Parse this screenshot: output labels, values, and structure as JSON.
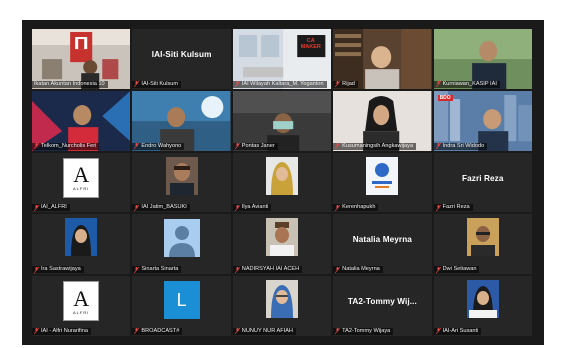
{
  "tiles": [
    {
      "label": "Ikatan Akuntan Indonesia 10"
    },
    {
      "label": "IAI-Siti Kulsum",
      "big": "IAI-Siti Kulsum"
    },
    {
      "label": "IAI Wilayah Kaltara_M. Yoganton",
      "sign": "CA MAKER"
    },
    {
      "label": "Rijad"
    },
    {
      "label": "Kurniawan_KASIP IAI"
    },
    {
      "label": "Telkom_Nurcholis Feri"
    },
    {
      "label": "Endro Wahyono"
    },
    {
      "label": "Pontas Janer"
    },
    {
      "label": "Kusumaningsih Angkawijaya"
    },
    {
      "label": "Indra Sri Widodo",
      "sign": "BDO"
    },
    {
      "label": "IAI_ALFRI",
      "logo_big": "A",
      "logo_small": "ALFRI"
    },
    {
      "label": "IAI Jatim_BASUKI"
    },
    {
      "label": "Ilya Avianti"
    },
    {
      "label": "Kerenhapukh"
    },
    {
      "label": "Fazri Reza",
      "big": "Fazri Reza"
    },
    {
      "label": "Ira Sastrawijaya"
    },
    {
      "label": "Sinarta Sinarta"
    },
    {
      "label": "NADIRSYAH IAI ACEH"
    },
    {
      "label": "Natalia Meyrna",
      "big": "Natalia Meyrna"
    },
    {
      "label": "Dwi Setiawan"
    },
    {
      "label": "IAI - Alfri Nurarifina",
      "logo_big": "A",
      "logo_small": "ALFRI"
    },
    {
      "label": "BROADCAST#",
      "logo_big": "L"
    },
    {
      "label": "NUNUY NUR AFIAH"
    },
    {
      "label": "TA2-Tommy Wijaya",
      "big": "TA2-Tommy  Wij..."
    },
    {
      "label": "IAI-Ari Susanti"
    }
  ]
}
